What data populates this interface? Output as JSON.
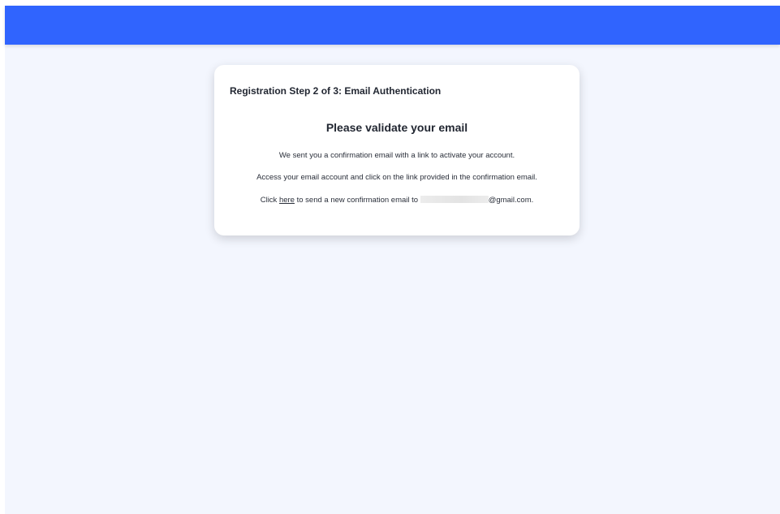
{
  "header": {
    "bar_color": "#3064fe"
  },
  "card": {
    "step_title": "Registration Step 2 of 3: Email Authentication",
    "heading": "Please validate your email",
    "line1": "We sent you a confirmation email with a link to activate your account.",
    "line2": "Access your email account and click on the link provided in the confirmation email.",
    "line3_prefix": "Click ",
    "line3_link": "here",
    "line3_middle": " to send a new confirmation email to ",
    "line3_email_domain": "@gmail.com."
  },
  "colors": {
    "page_background": "#f3f6fe",
    "card_background": "#ffffff"
  }
}
